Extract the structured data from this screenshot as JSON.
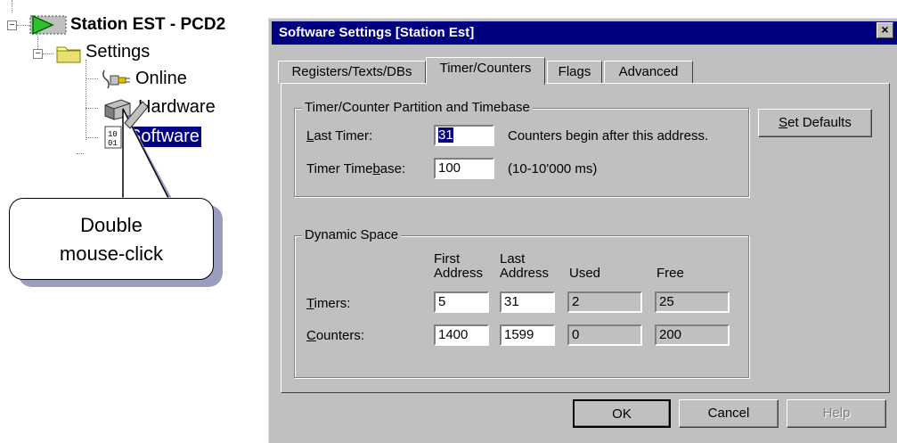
{
  "tree": {
    "station": "Station EST - PCD2",
    "settings": "Settings",
    "online": "Online",
    "hardware": "Hardware",
    "software": "Software"
  },
  "callout": {
    "line1": "Double",
    "line2": "mouse-click"
  },
  "dialog": {
    "title": "Software Settings [Station Est]",
    "close": "×",
    "tabs": [
      "Registers/Texts/DBs",
      "Timer/Counters",
      "Flags",
      "Advanced"
    ],
    "active_tab": "Timer/Counters",
    "partition": {
      "title": "Timer/Counter Partition and Timebase",
      "last_timer_label_u": "L",
      "last_timer_label_rest": "ast Timer:",
      "last_timer_value": "31",
      "last_timer_note": "Counters begin after this address.",
      "timebase_label_pre": "Timer Time",
      "timebase_label_u": "b",
      "timebase_label_rest": "ase:",
      "timebase_value": "100",
      "timebase_note": "(10-10'000 ms)"
    },
    "set_defaults_u": "S",
    "set_defaults_rest": "et Defaults",
    "dynamic": {
      "title": "Dynamic Space",
      "col_first_1": "First",
      "col_first_2": "Address",
      "col_last_1": "Last",
      "col_last_2": "Address",
      "col_used": "Used",
      "col_free": "Free",
      "rows": [
        {
          "label_u": "T",
          "label_rest": "imers:",
          "first": "5",
          "last": "31",
          "used": "2",
          "free": "25"
        },
        {
          "label_u": "C",
          "label_rest": "ounters:",
          "first": "1400",
          "last": "1599",
          "used": "0",
          "free": "200"
        }
      ]
    },
    "ok": "OK",
    "cancel": "Cancel",
    "help": "Help"
  },
  "colors": {
    "titlebar": "#000080",
    "dialog_bg": "#c0c0c0",
    "selection": "#000080",
    "callout_shadow": "#9a9cc0"
  }
}
